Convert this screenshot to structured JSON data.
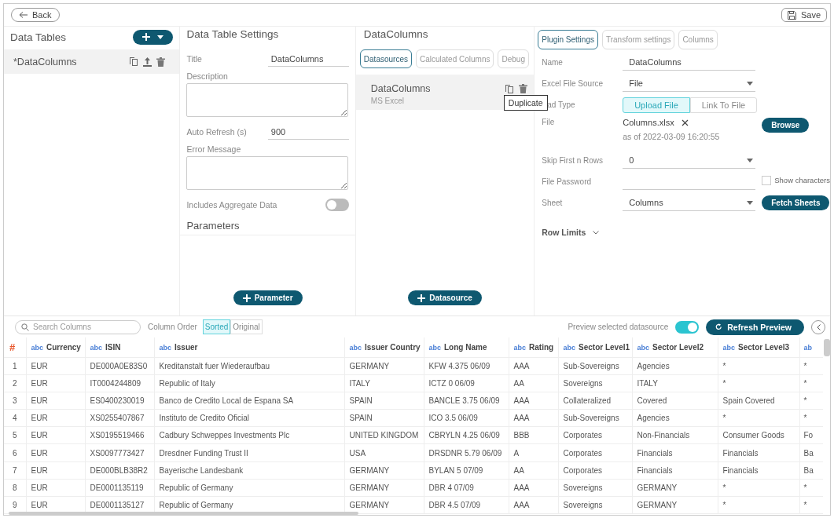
{
  "top_bar": {
    "back_button": "Back",
    "save_button": "Save"
  },
  "data_tables": {
    "title": "Data Tables",
    "items": [
      {
        "label": "*DataColumns",
        "selected": true
      }
    ]
  },
  "table_settings": {
    "title": "Data Table Settings",
    "fields": [
      {
        "kind": "input",
        "label": "Title",
        "value": "DataColumns"
      },
      {
        "kind": "textarea",
        "label": "Description"
      },
      {
        "kind": "input",
        "label": "Auto Refresh (s)",
        "value": "900"
      },
      {
        "kind": "textarea",
        "label": "Error Message"
      },
      {
        "kind": "toggle",
        "label": "Includes Aggregate Data",
        "on": false
      }
    ],
    "parameters_title": "Parameters",
    "add_parameter_button": "Parameter"
  },
  "datacolumns": {
    "title": "DataColumns",
    "tabs": [
      {
        "label": "Datasources",
        "selected": true
      },
      {
        "label": "Calculated Columns",
        "selected": false
      },
      {
        "label": "Debug",
        "selected": false
      }
    ],
    "sources": [
      {
        "name": "DataColumns",
        "type": "MS Excel",
        "selected": true
      }
    ],
    "tooltip": "Duplicate",
    "add_datasource_button": "Datasource"
  },
  "plugin": {
    "tabs": [
      {
        "label": "Plugin Settings",
        "selected": true
      },
      {
        "label": "Transform settings",
        "selected": false
      },
      {
        "label": "Columns",
        "selected": false
      }
    ],
    "rows": [
      {
        "kind": "input",
        "label": "Name",
        "value": "DataColumns"
      },
      {
        "kind": "dropdown",
        "label": "Excel File Source",
        "value": "File"
      },
      {
        "kind": "segmented",
        "label": "ad Type",
        "options": [
          {
            "label": "Upload File",
            "selected": true
          },
          {
            "label": "Link To File",
            "selected": false
          }
        ]
      },
      {
        "kind": "file",
        "label": "File",
        "file_name": "Columns.xlsx",
        "timestamp": "as of 2022-03-09 16:20:55",
        "button": "Browse"
      },
      {
        "kind": "dropdown",
        "label": "Skip First n Rows",
        "value": "0"
      },
      {
        "kind": "password",
        "label": "File Password",
        "checkbox": {
          "label": "Show characters",
          "checked": false
        }
      },
      {
        "kind": "dropdown",
        "label": "Sheet",
        "value": "Columns",
        "button": "Fetch Sheets"
      }
    ],
    "row_limits": {
      "label": "Row Limits",
      "expanded": false
    }
  },
  "preview": {
    "search_placeholder": "Search Columns",
    "column_order_label": "Column Order",
    "order_options": [
      {
        "label": "Sorted",
        "selected": true
      },
      {
        "label": "Original",
        "selected": false
      }
    ],
    "preview_toggle": {
      "label": "Preview selected datasource",
      "on": true
    },
    "refresh_button": "Refresh Preview"
  },
  "table": {
    "columns": [
      {
        "name": "#"
      },
      {
        "type": "abc",
        "name": "Currency"
      },
      {
        "type": "abc",
        "name": "ISIN"
      },
      {
        "type": "abc",
        "name": "Issuer"
      },
      {
        "type": "abc",
        "name": "Issuer Country"
      },
      {
        "type": "abc",
        "name": "Long Name"
      },
      {
        "type": "abc",
        "name": "Rating"
      },
      {
        "type": "abc",
        "name": "Sector Level1"
      },
      {
        "type": "abc",
        "name": "Sector Level2"
      },
      {
        "type": "abc",
        "name": "Sector Level3"
      },
      {
        "type": "ab"
      }
    ],
    "rows": [
      [
        "1",
        "EUR",
        "DE000A0E83S0",
        "Kreditanstalt fuer Wiederaufbau",
        "GERMANY",
        "KFW 4.375 06/09",
        "AAA",
        "Sub-Sovereigns",
        "Agencies",
        "*",
        "*"
      ],
      [
        "2",
        "EUR",
        "IT0004244809",
        "Republic of Italy",
        "ITALY",
        "ICTZ 0 06/09",
        "AA",
        "Sovereigns",
        "ITALY",
        "*",
        "*"
      ],
      [
        "3",
        "EUR",
        "ES0400230019",
        "Banco de Credito Local de Espana SA",
        "SPAIN",
        "BANCLE 3.75 06/09",
        "AAA",
        "Collateralized",
        "Covered",
        "Spain Covered",
        "*"
      ],
      [
        "4",
        "EUR",
        "XS0255407867",
        "Instituto de Credito Oficial",
        "SPAIN",
        "ICO 3.5 06/09",
        "AAA",
        "Sub-Sovereigns",
        "Agencies",
        "*",
        "*"
      ],
      [
        "5",
        "EUR",
        "XS0195519466",
        "Cadbury Schweppes Investments Plc",
        "UNITED KINGDOM",
        "CBRYLN 4.25 06/09",
        "BBB",
        "Corporates",
        "Non-Financials",
        "Consumer Goods",
        "Fo"
      ],
      [
        "6",
        "EUR",
        "XS0097773427",
        "Dresdner Funding Trust II",
        "USA",
        "DRSDNR 5.79 06/09",
        "A",
        "Corporates",
        "Financials",
        "Financials",
        "Ba"
      ],
      [
        "7",
        "EUR",
        "DE000BLB38R2",
        "Bayerische Landesbank",
        "GERMANY",
        "BYLAN 5 07/09",
        "AA",
        "Corporates",
        "Financials",
        "Financials",
        "Ba"
      ],
      [
        "8",
        "EUR",
        "DE0001135119",
        "Republic of Germany",
        "GERMANY",
        "DBR 4 07/09",
        "AAA",
        "Sovereigns",
        "GERMANY",
        "*",
        "*"
      ],
      [
        "9",
        "EUR",
        "DE0001135127",
        "Republic of Germany",
        "GERMANY",
        "DBR 4.5 07/09",
        "AAA",
        "Sovereigns",
        "GERMANY",
        "*",
        "*"
      ]
    ]
  }
}
